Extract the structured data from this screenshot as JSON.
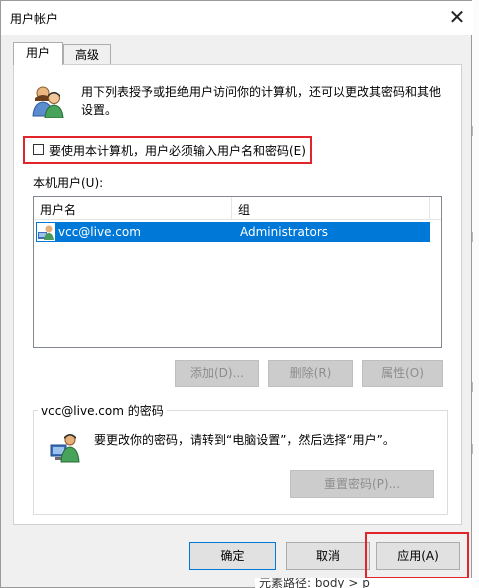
{
  "window": {
    "title": "用户帐户",
    "close_glyph": "✕"
  },
  "tabs": [
    {
      "label": "用户",
      "active": true
    },
    {
      "label": "高级",
      "active": false
    }
  ],
  "intro_text": "用下列表授予或拒绝用户访问你的计算机，还可以更改其密码和其他设置。",
  "require_login": {
    "label": "要使用本计算机，用户必须输入用户名和密码(E)",
    "checked": false
  },
  "users_section": {
    "label": "本机用户(U):"
  },
  "users_table": {
    "columns": [
      "用户名",
      "组"
    ],
    "rows": [
      {
        "name": "vcc@live.com",
        "group": "Administrators",
        "selected": true
      }
    ]
  },
  "user_buttons": {
    "add": "添加(D)...",
    "remove": "删除(R)",
    "properties": "属性(O)"
  },
  "password_section": {
    "title": "vcc@live.com 的密码",
    "message": "要更改你的密码，请转到“电脑设置”，然后选择“用户”。",
    "reset_button": "重置密码(P)..."
  },
  "footer_buttons": {
    "ok": "确定",
    "cancel": "取消",
    "apply": "应用(A)"
  },
  "background_text": {
    "breadcrumb": "元素路径: body > p"
  },
  "colors": {
    "selection": "#0078d7",
    "highlight_box": "#e0262b",
    "button_face": "#e1e1e1"
  },
  "icons": [
    "users-icon",
    "user-key-icon",
    "user-row-icon",
    "close-icon"
  ]
}
